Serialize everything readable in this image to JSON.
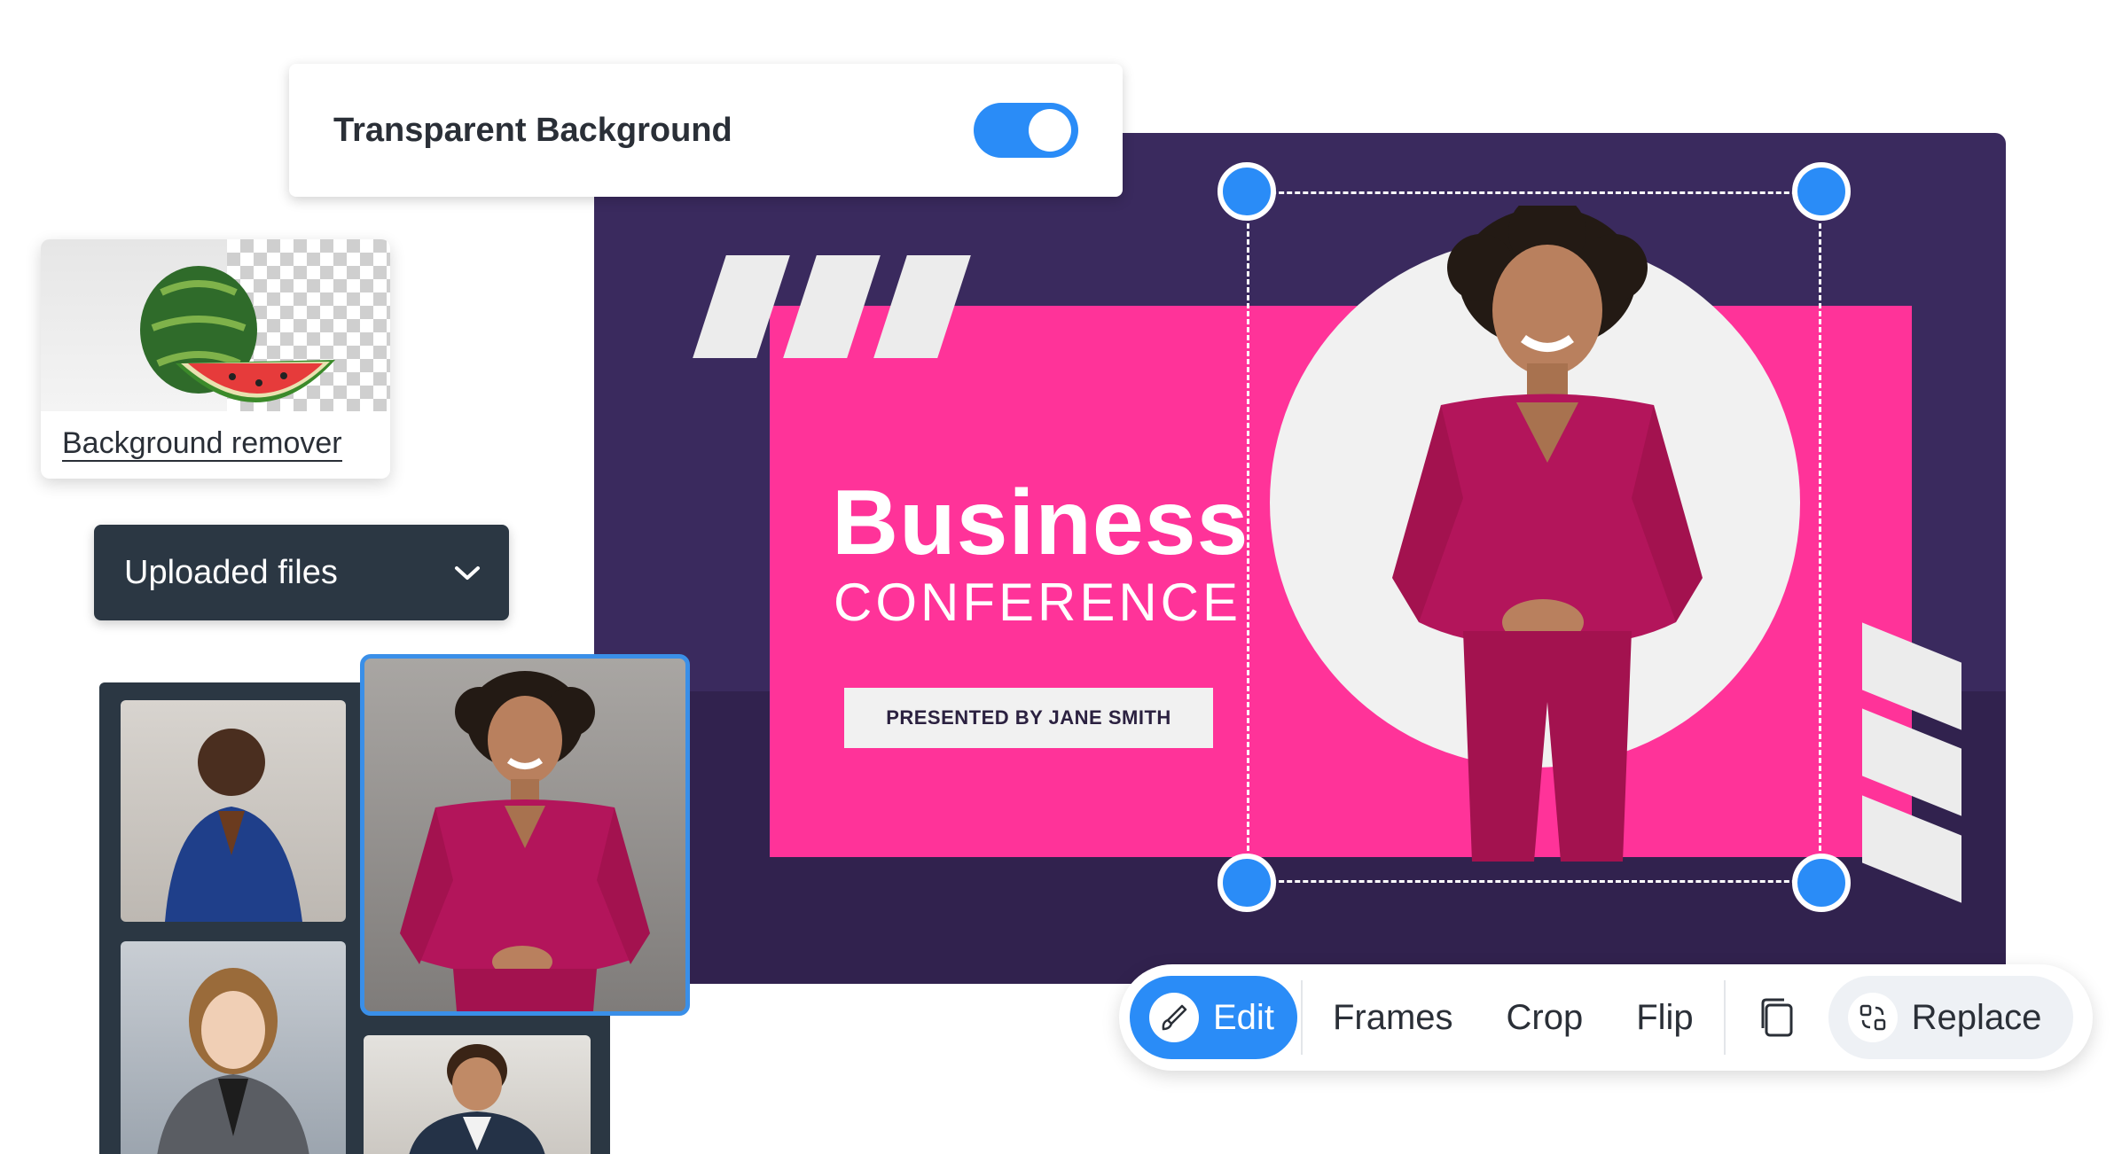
{
  "toggle_card": {
    "label": "Transparent Background",
    "enabled": true
  },
  "bg_remover": {
    "label": "Background remover"
  },
  "uploaded": {
    "label": "Uploaded files"
  },
  "design": {
    "title": "Business",
    "subtitle": "CONFERENCE",
    "presented": "PRESENTED BY JANE SMITH"
  },
  "toolbar": {
    "edit": "Edit",
    "frames": "Frames",
    "crop": "Crop",
    "flip": "Flip",
    "replace": "Replace"
  },
  "colors": {
    "accent": "#2a8cf7",
    "canvas_bg": "#3a2a5e",
    "pink": "#ff3399",
    "panel": "#2b3743"
  }
}
